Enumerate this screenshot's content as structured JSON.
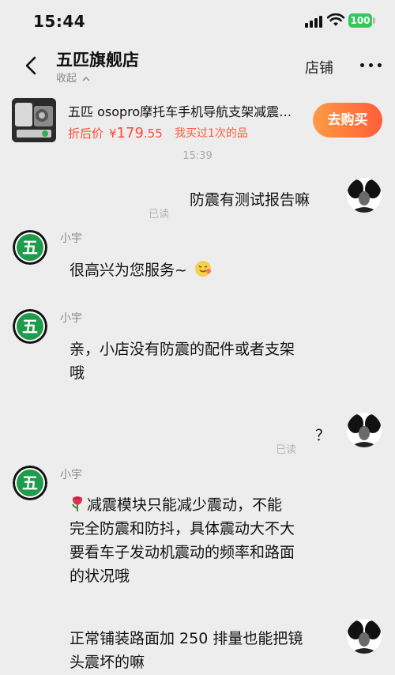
{
  "status_bar": {
    "time": "15:44",
    "battery": "100"
  },
  "header": {
    "shop_name": "五匹旗舰店",
    "collapse_label": "收起",
    "store_label": "店铺"
  },
  "product": {
    "title": "五匹 osopro摩托车手机导航支架减震…",
    "price_label": "折后价",
    "price_currency": "¥",
    "price_int": "179",
    "price_dec": ".55",
    "bought_note": "我买过1次的品",
    "buy_label": "去购买"
  },
  "timestamp": "15:39",
  "messages": [
    {
      "side": "right",
      "text": "防震有测试报告嘛",
      "status": "已读"
    },
    {
      "side": "left",
      "sender": "小宇",
      "text": "很高兴为您服务~"
    },
    {
      "side": "left",
      "sender": "小宇",
      "lines": [
        "亲，小店没有防震的配件或者支架",
        "哦"
      ]
    },
    {
      "side": "right",
      "text": "？",
      "status": "已读"
    },
    {
      "side": "left",
      "sender": "小宇",
      "lines": [
        "减震模块只能减少震动，不能",
        "完全防震和防抖，具体震动大不大",
        "要看车子发动机震动的频率和路面",
        "的状况哦"
      ]
    },
    {
      "side": "right",
      "lines": [
        "正常铺装路面加 250 排量也能把镜",
        "头震坏的嘛"
      ]
    }
  ],
  "icons": [
    "back-icon",
    "chevron-up-icon",
    "more-icon",
    "signal-icon",
    "wifi-icon",
    "battery-icon",
    "smile-emoji-icon",
    "rose-emoji-icon"
  ],
  "colors": {
    "background": "#ededed",
    "price": "#ff4a3a",
    "buy_gradient_start": "#ff9a44",
    "buy_gradient_end": "#ff5e3a",
    "avatar_green": "#1f9b4c"
  }
}
